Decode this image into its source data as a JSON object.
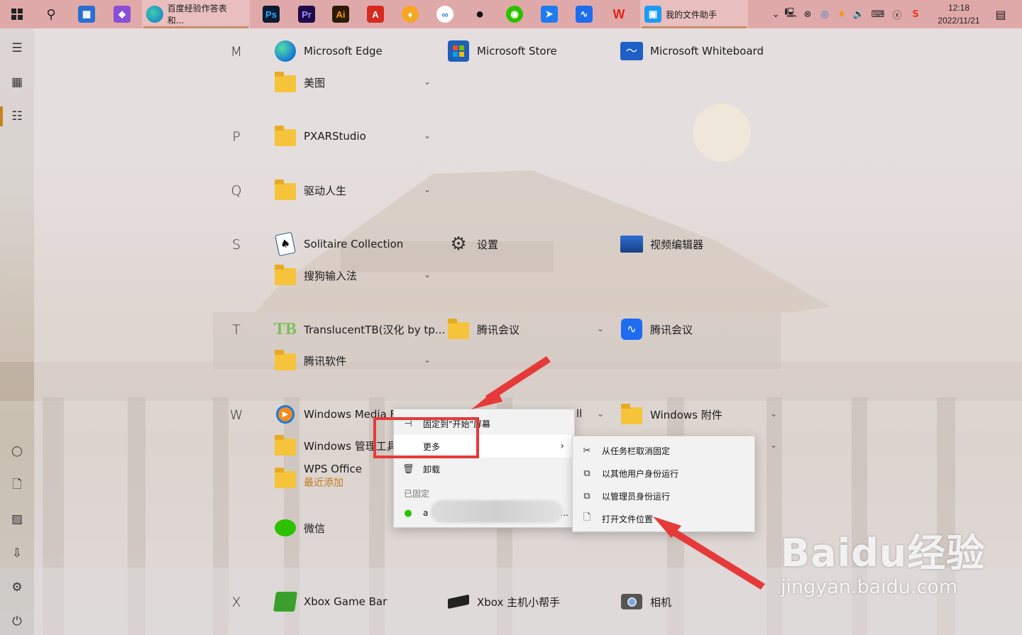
{
  "taskbar": {
    "tasks": [
      {
        "label": "百度经验作答表 和...",
        "icon": "edge-icon"
      },
      {
        "label": "我的文件助手",
        "icon": "file-assistant-icon"
      }
    ],
    "pinned": [
      {
        "name": "store",
        "text": ""
      },
      {
        "name": "photoshop",
        "text": "Ps"
      },
      {
        "name": "premiere",
        "text": "Pr"
      },
      {
        "name": "illustrator",
        "text": "Ai"
      },
      {
        "name": "acrobat",
        "text": "A"
      }
    ],
    "clock": {
      "time": "12:18",
      "date": "2022/11/21"
    },
    "colors": {
      "bg": "#e0a9a9",
      "accent": "#c78d6a"
    }
  },
  "applist": {
    "groups": [
      {
        "letter": "M",
        "items": [
          "Microsoft Edge",
          "Microsoft Store",
          "Microsoft Whiteboard",
          "美图"
        ]
      },
      {
        "letter": "P",
        "items": [
          "PXARStudio"
        ]
      },
      {
        "letter": "Q",
        "items": [
          "驱动人生"
        ]
      },
      {
        "letter": "S",
        "items": [
          "Solitaire Collection",
          "设置",
          "视频编辑器",
          "搜狗输入法"
        ]
      },
      {
        "letter": "T",
        "items": [
          "TranslucentTB(汉化 by tp...",
          "腾讯会议",
          "腾讯会议",
          "腾讯软件"
        ]
      },
      {
        "letter": "W",
        "items": [
          "Windows Media F",
          "Windows 附件",
          "Windows 管理工具",
          "WPS Office"
        ]
      },
      {
        "letter": "X",
        "items": [
          "Xbox Game Bar",
          "Xbox 主机小帮手",
          "相机"
        ]
      }
    ],
    "recent_label": "最近添加",
    "wechat": "微信",
    "partial_right": "ll"
  },
  "context_menu": {
    "items": [
      "固定到\"开始\"屏幕",
      "更多",
      "卸载"
    ],
    "pinned_header": "已固定",
    "pinned_item_prefix": "a",
    "ellipsis": "..."
  },
  "submenu": {
    "items": [
      "从任务栏取消固定",
      "以其他用户身份运行",
      "以管理员身份运行",
      "打开文件位置"
    ]
  },
  "behind_menu_text": "幕",
  "watermark": {
    "main": "Baidu经验",
    "sub": "jingyan.baidu.com"
  }
}
